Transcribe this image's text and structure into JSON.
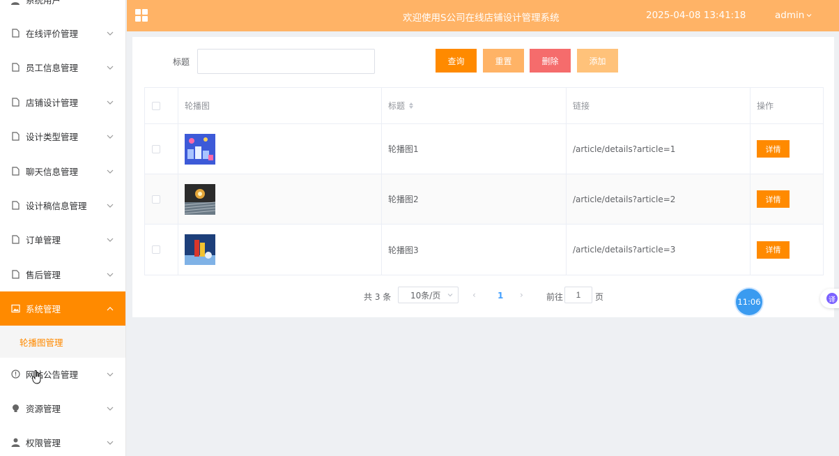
{
  "header": {
    "title": "欢迎使用S公司在线店铺设计管理系统",
    "datetime": "2025-04-08 13:41:18",
    "user": "admin"
  },
  "sidebar": {
    "partial_top_label": "系统用户",
    "items": [
      {
        "label": "在线评价管理",
        "icon": "document-icon"
      },
      {
        "label": "员工信息管理",
        "icon": "document-icon"
      },
      {
        "label": "店铺设计管理",
        "icon": "document-icon"
      },
      {
        "label": "设计类型管理",
        "icon": "document-icon"
      },
      {
        "label": "聊天信息管理",
        "icon": "document-icon"
      },
      {
        "label": "设计稿信息管理",
        "icon": "document-icon"
      },
      {
        "label": "订单管理",
        "icon": "document-icon"
      },
      {
        "label": "售后管理",
        "icon": "document-icon"
      },
      {
        "label": "系统管理",
        "icon": "picture-icon",
        "active": true
      },
      {
        "label": "网站公告管理",
        "icon": "info-circle-icon"
      },
      {
        "label": "资源管理",
        "icon": "bulb-icon"
      },
      {
        "label": "权限管理",
        "icon": "user-icon"
      }
    ],
    "submenu": {
      "label": "轮播图管理"
    }
  },
  "search": {
    "label": "标题",
    "value": "",
    "placeholder": ""
  },
  "buttons": {
    "query": "查询",
    "reset": "重置",
    "delete": "删除",
    "add": "添加"
  },
  "table": {
    "columns": [
      "轮播图",
      "标题",
      "链接",
      "操作"
    ],
    "rows": [
      {
        "title": "轮播图1",
        "link": "/article/details?article=1",
        "action": "详情"
      },
      {
        "title": "轮播图2",
        "link": "/article/details?article=2",
        "action": "详情"
      },
      {
        "title": "轮播图3",
        "link": "/article/details?article=3",
        "action": "详情"
      }
    ]
  },
  "pagination": {
    "total_text": "共 3 条",
    "page_size": "10条/页",
    "current_page": "1",
    "goto_label": "前往",
    "goto_value": "1",
    "page_suffix": "页"
  },
  "floating": {
    "clock": "11:06",
    "translate": "译"
  },
  "colors": {
    "accent": "#ff8a00",
    "header_bg": "#ffb366",
    "danger": "#f56c6c",
    "clock_bg": "#3a9bf0"
  }
}
